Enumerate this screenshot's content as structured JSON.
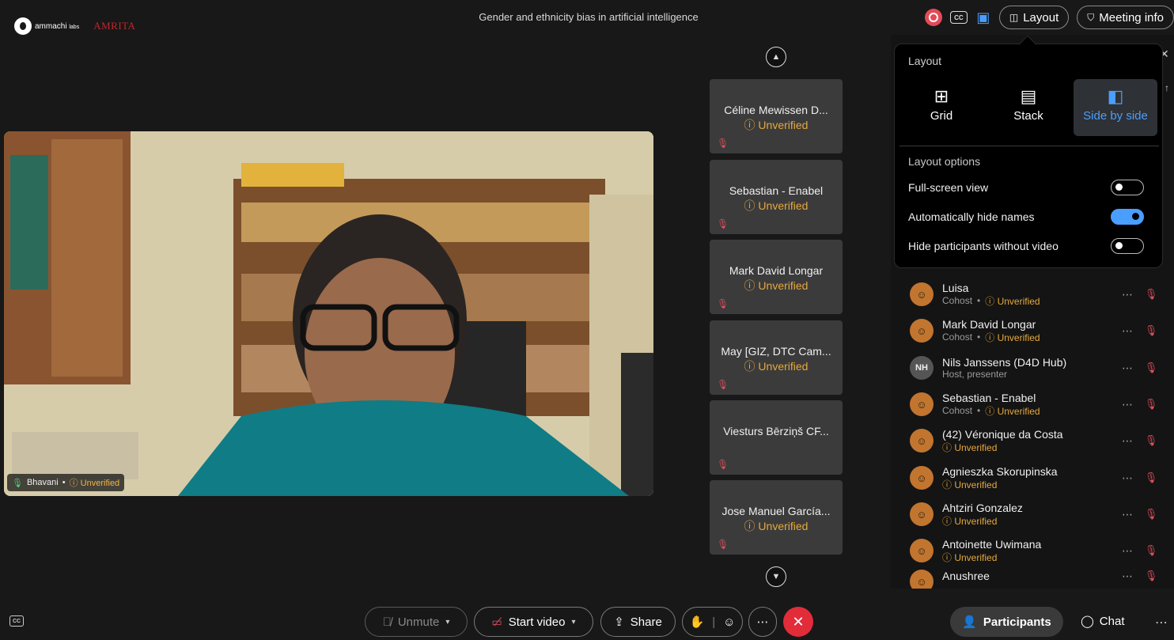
{
  "header": {
    "brand_name": "ammachi",
    "brand_suffix": "labs",
    "partner_logo": "AMRITA",
    "meeting_title": "Gender and ethnicity bias in artificial intelligence",
    "layout_label": "Layout",
    "meeting_info_label": "Meeting info",
    "cc_label": "CC"
  },
  "main_video": {
    "name": "Bhavani",
    "status": "Unverified"
  },
  "tiles": [
    {
      "name": "Céline Mewissen D...",
      "status": "Unverified"
    },
    {
      "name": "Sebastian - Enabel",
      "status": "Unverified"
    },
    {
      "name": "Mark David Longar",
      "status": "Unverified"
    },
    {
      "name": "May [GIZ, DTC Cam...",
      "status": "Unverified"
    },
    {
      "name": "Viesturs Bērziņš CF...",
      "status": ""
    },
    {
      "name": "Jose Manuel García...",
      "status": "Unverified"
    }
  ],
  "layout_popup": {
    "title": "Layout",
    "options": [
      {
        "label": "Grid",
        "selected": false
      },
      {
        "label": "Stack",
        "selected": false
      },
      {
        "label": "Side by side",
        "selected": true
      }
    ],
    "options_title": "Layout options",
    "toggles": [
      {
        "label": "Full-screen view",
        "on": false
      },
      {
        "label": "Automatically hide names",
        "on": true
      },
      {
        "label": "Hide participants without video",
        "on": false
      }
    ]
  },
  "participants": [
    {
      "name": "Luisa",
      "role": "Cohost",
      "status": "Unverified",
      "initials": ""
    },
    {
      "name": "Mark David Longar",
      "role": "Cohost",
      "status": "Unverified",
      "initials": ""
    },
    {
      "name": "Nils Janssens (D4D Hub)",
      "role": "Host, presenter",
      "status": "",
      "initials": "NH"
    },
    {
      "name": "Sebastian - Enabel",
      "role": "Cohost",
      "status": "Unverified",
      "initials": ""
    },
    {
      "name": "(42) Véronique da Costa",
      "role": "",
      "status": "Unverified",
      "initials": ""
    },
    {
      "name": "Agnieszka Skorupinska",
      "role": "",
      "status": "Unverified",
      "initials": ""
    },
    {
      "name": "Ahtziri Gonzalez",
      "role": "",
      "status": "Unverified",
      "initials": ""
    },
    {
      "name": "Antoinette Uwimana",
      "role": "",
      "status": "Unverified",
      "initials": ""
    },
    {
      "name": "Anushree",
      "role": "",
      "status": "",
      "initials": ""
    }
  ],
  "controls": {
    "unmute": "Unmute",
    "start_video": "Start video",
    "share": "Share",
    "participants": "Participants",
    "chat": "Chat"
  },
  "colors": {
    "accent": "#4a9eff",
    "unverified": "#e6a83d",
    "end_call": "#e22c3a",
    "muted_icon": "#e0505e"
  }
}
